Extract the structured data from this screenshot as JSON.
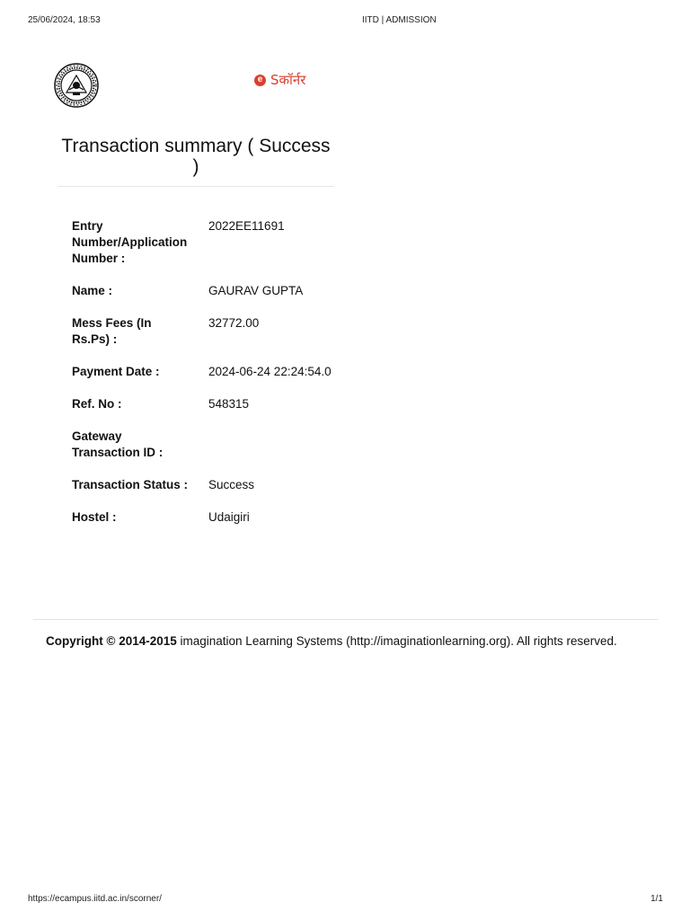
{
  "print_header": {
    "datetime": "25/06/2024, 18:53",
    "title": "IITD | ADMISSION"
  },
  "print_footer": {
    "url": "https://ecampus.iitd.ac.in/scorner/",
    "page": "1/1"
  },
  "brand": {
    "icon": "e",
    "text": "Sकॉर्नर",
    "color": "#d9412f"
  },
  "page_title": "Transaction summary ( Success )",
  "details": [
    {
      "label": "Entry Number/Application Number :",
      "value": "2022EE11691"
    },
    {
      "label": "Name :",
      "value": "GAURAV GUPTA"
    },
    {
      "label": "Mess Fees (In Rs.Ps) :",
      "value": "32772.00"
    },
    {
      "label": "Payment Date :",
      "value": "2024-06-24 22:24:54.0"
    },
    {
      "label": "Ref. No :",
      "value": "548315"
    },
    {
      "label": "Gateway Transaction ID :",
      "value": ""
    },
    {
      "label": "Transaction Status :",
      "value": "Success"
    },
    {
      "label": "Hostel :",
      "value": "Udaigiri"
    }
  ],
  "footer": {
    "copyright_bold": "Copyright © 2014-2015",
    "copyright_text": " imagination Learning Systems (http://imaginationlearning.org). All rights reserved."
  }
}
